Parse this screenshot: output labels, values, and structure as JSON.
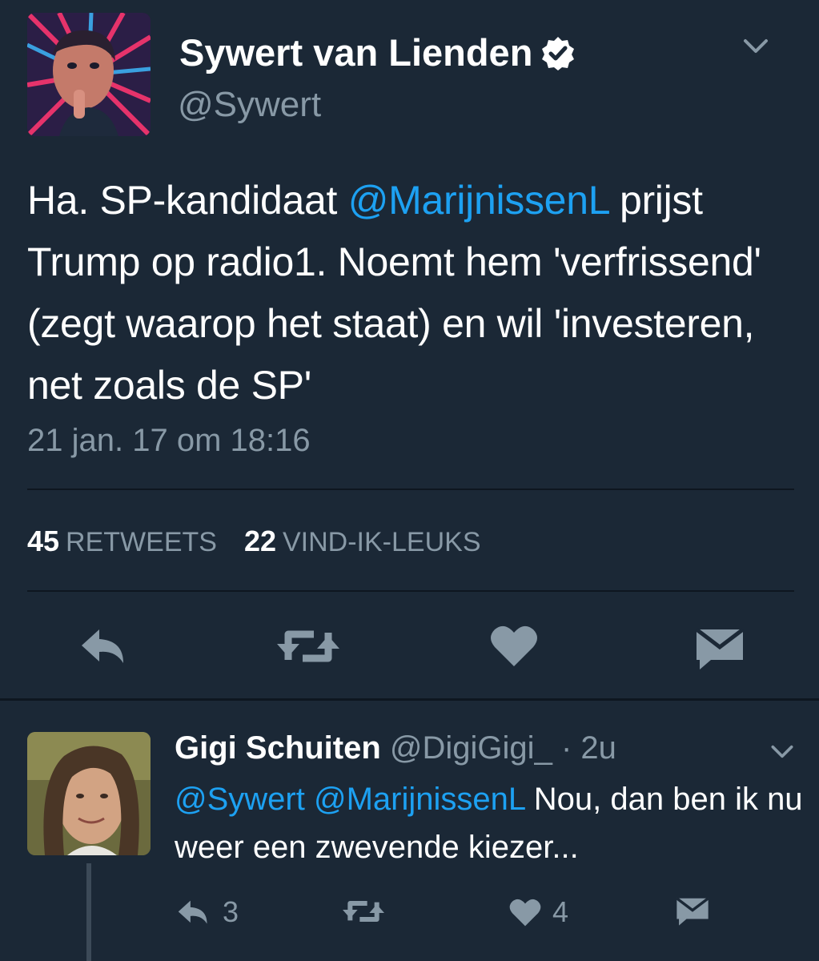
{
  "tweet": {
    "author_name": "Sywert van Lienden",
    "author_handle": "@Sywert",
    "text_before": "Ha. SP-kandidaat ",
    "mention": "@MarijnissenL",
    "text_after": " prijst Trump op radio1. Noemt hem 'verfrissend' (zegt waarop het staat) en wil 'investeren, net zoals de SP'",
    "timestamp": "21 jan. 17 om 18:16",
    "stats": {
      "retweets_count": "45",
      "retweets_label": "RETWEETS",
      "likes_count": "22",
      "likes_label": "VIND-IK-LEUKS"
    },
    "icons": [
      "avatar",
      "verified-badge-icon",
      "chevron-down-icon",
      "reply-icon",
      "retweet-icon",
      "heart-icon",
      "message-icon"
    ]
  },
  "reply": {
    "author_name": "Gigi Schuiten",
    "author_handle": "@DigiGigi_",
    "separator": "·",
    "time": "2u",
    "mention1": "@Sywert",
    "mention2": "@MarijnissenL",
    "text": " Nou, dan ben ik nu weer een zwevende kiezer...",
    "reply_count": "3",
    "like_count": "4"
  },
  "colors": {
    "background": "#1b2836",
    "link": "#1da1f2",
    "muted": "#8899a6",
    "icon": "#8899a6"
  }
}
